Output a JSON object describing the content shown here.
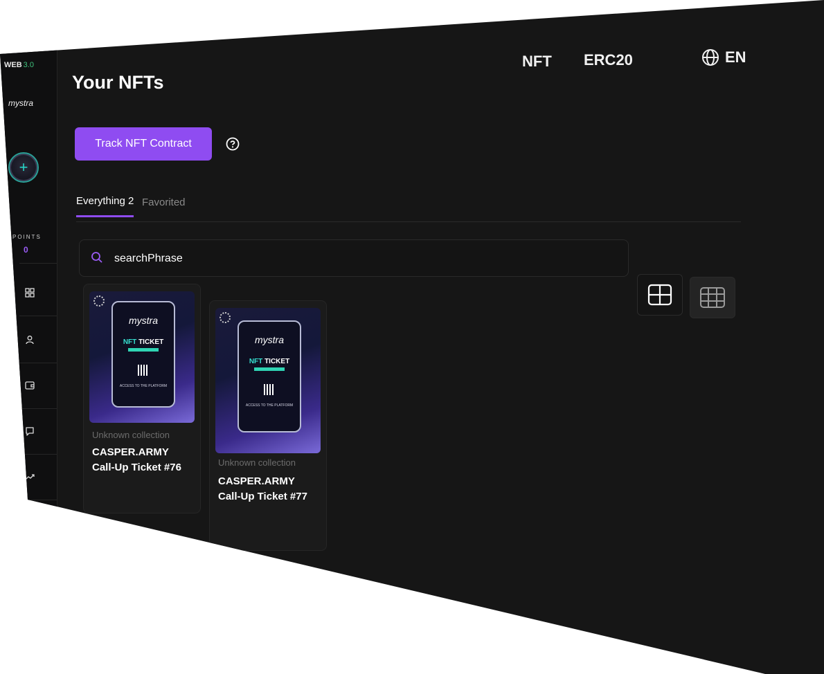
{
  "sidebar": {
    "brand": "WEB",
    "brand_version": "3.0",
    "logo_text": "mystra",
    "points_label": "POINTS",
    "points_value": "0",
    "nav_icons": [
      "grid-icon",
      "user-icon",
      "wallet-icon",
      "chat-icon",
      "trending-icon"
    ]
  },
  "header": {
    "title": "Your NFTs",
    "nav_nft": "NFT",
    "nav_erc20": "ERC20",
    "language": "EN"
  },
  "actions": {
    "track_button": "Track NFT Contract"
  },
  "tabs": [
    {
      "label": "Everything 2",
      "active": true
    },
    {
      "label": "Favorited",
      "active": false
    }
  ],
  "search": {
    "value": "searchPhrase"
  },
  "cards": [
    {
      "collection": "Unknown collection",
      "name": "CASPER.ARMY Call-Up Ticket #76",
      "image_logo": "mystra",
      "image_nft": "NFT",
      "image_ticket": "TICKET",
      "image_caption": "ACCESS TO THE PLATFORM"
    },
    {
      "collection": "Unknown collection",
      "name": "CASPER.ARMY Call-Up Ticket #77",
      "image_logo": "mystra",
      "image_nft": "NFT",
      "image_ticket": "TICKET",
      "image_caption": "ACCESS TO THE PLATFORM"
    }
  ],
  "colors": {
    "accent": "#8f4cf1",
    "background": "#161616",
    "sidebar": "#0f0f10",
    "teal": "#27d4c6"
  }
}
